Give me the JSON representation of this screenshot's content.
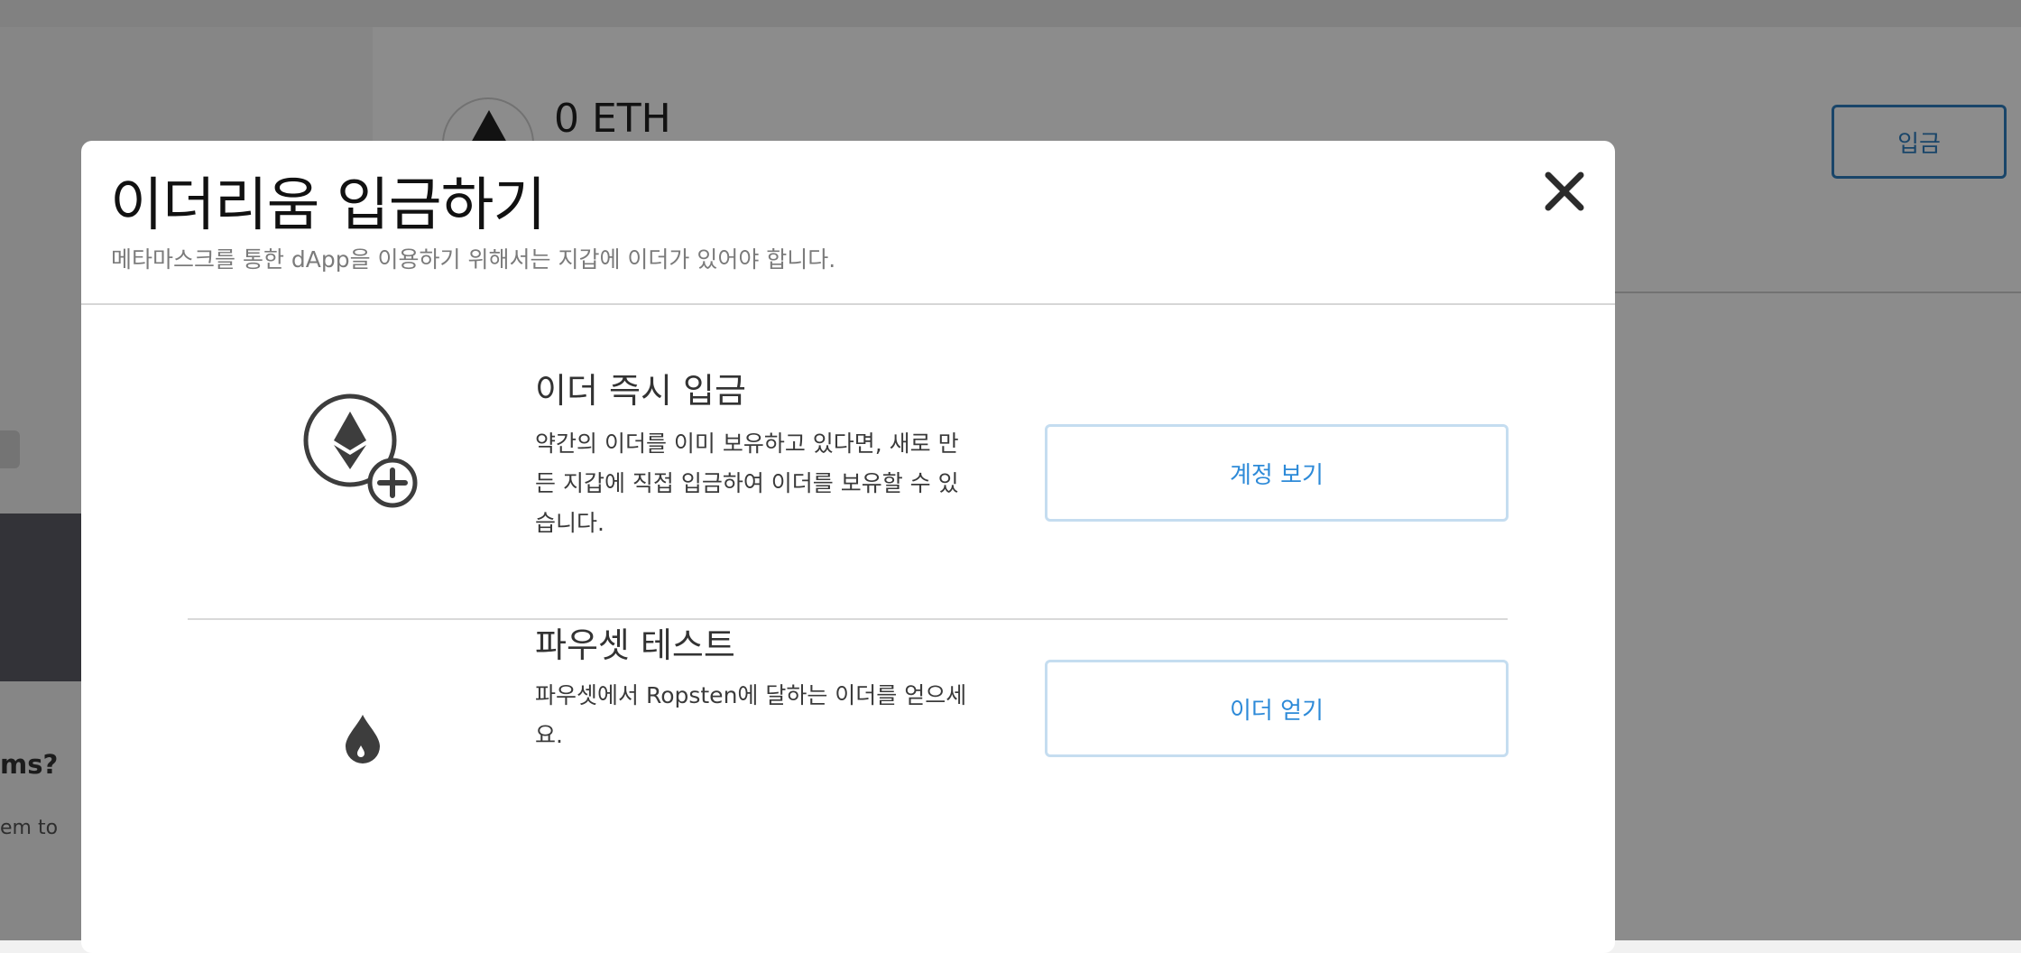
{
  "background_app": {
    "balance": "0 ETH",
    "deposit_button": "입금",
    "sidebar_question_fragment": "ms?",
    "sidebar_text_fragment": "em to"
  },
  "modal": {
    "title": "이더리움 입금하기",
    "subtitle": "메타마스크를 통한 dApp을 이용하기 위해서는 지갑에 이더가 있어야 합니다.",
    "close_icon": "close-icon",
    "options": [
      {
        "icon": "ether-deposit-icon",
        "title": "이더 즉시 입금",
        "text": "약간의 이더를 이미 보유하고 있다면, 새로 만든 지갑에 직접 입금하여 이더를 보유할 수 있습니다.",
        "button_label": "계정 보기"
      },
      {
        "icon": "faucet-drop-icon",
        "title": "파우셋 테스트",
        "text": "파우셋에서 Ropsten에 달하는 이더를 얻으세요.",
        "button_label": "이더 얻기"
      }
    ]
  },
  "colors": {
    "accent": "#2d8ad8",
    "button_border": "#c5ddf0",
    "overlay": "rgba(0,0,0,0.45)"
  }
}
